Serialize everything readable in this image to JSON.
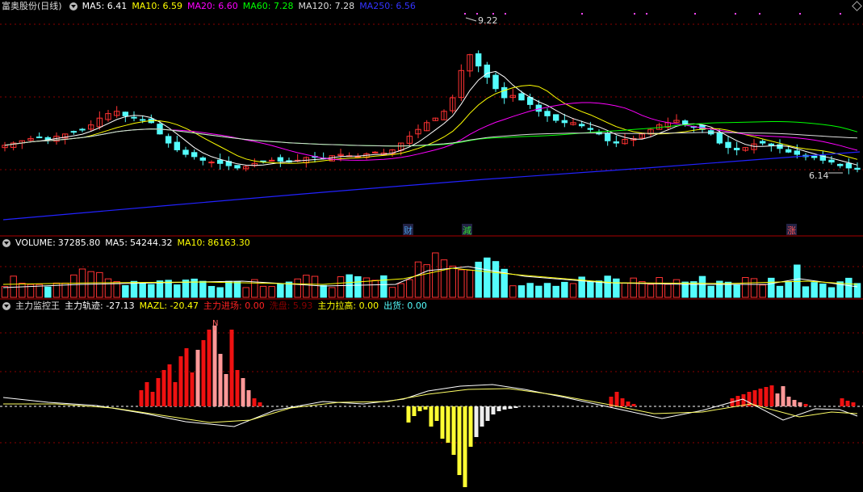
{
  "stock": {
    "name": "富奥股份",
    "period": "(日线)"
  },
  "price_panel": {
    "ma_labels": [
      {
        "label": "MA5",
        "value": "6.41",
        "color": "#ffffff"
      },
      {
        "label": "MA10",
        "value": "6.59",
        "color": "#ffff00"
      },
      {
        "label": "MA20",
        "value": "6.60",
        "color": "#ff00ff"
      },
      {
        "label": "MA60",
        "value": "7.28",
        "color": "#00ff00"
      },
      {
        "label": "MA120",
        "value": "7.28",
        "color": "#dddddd"
      },
      {
        "label": "MA250",
        "value": "6.56",
        "color": "#3333ff"
      }
    ],
    "high_label": "9.22",
    "low_label": "6.14",
    "event_markers": [
      {
        "text": "财",
        "color": "#4a9ae0"
      },
      {
        "text": "減",
        "color": "#33dd33"
      },
      {
        "text": "涨",
        "color": "#ff5555"
      }
    ]
  },
  "volume_panel": {
    "title": "VOLUME:",
    "value": "37285.80",
    "ma5_label": "MA5:",
    "ma5_value": "54244.32",
    "ma10_label": "MA10:",
    "ma10_value": "86163.30"
  },
  "indicator_panel": {
    "name": "主力监控王",
    "items": [
      {
        "label": "主力轨迹:",
        "value": "-27.13",
        "color": "#ffffff"
      },
      {
        "label": "MAZL:",
        "value": "-20.47",
        "color": "#ffff00"
      },
      {
        "label": "主力进场:",
        "value": "0.00",
        "color": "#ff2222"
      },
      {
        "label": "洗盘:",
        "value": "5.93",
        "color": "#880000"
      },
      {
        "label": "主力拉高:",
        "value": "0.00",
        "color": "#ffff00"
      },
      {
        "label": "出货:",
        "value": "0.00",
        "color": "#55ffff"
      }
    ],
    "entry_marker": "N"
  },
  "colors": {
    "up": "#ff3232",
    "down": "#54fcfc",
    "grid": "#8b0000",
    "bg": "#000000"
  },
  "chart_data": [
    {
      "type": "candlestick",
      "title": "富奥股份 (日线)",
      "ma_series": [
        "MA5",
        "MA10",
        "MA20",
        "MA60",
        "MA120",
        "MA250"
      ],
      "ylim": [
        5.2,
        9.8
      ],
      "highest": 9.22,
      "lowest": 6.14
    },
    {
      "type": "bar",
      "title": "VOLUME",
      "series": [
        {
          "name": "VOLUME",
          "last": 37285.8
        },
        {
          "name": "MA5",
          "last": 54244.32
        },
        {
          "name": "MA10",
          "last": 86163.3
        }
      ]
    },
    {
      "type": "bar",
      "title": "主力监控王",
      "series": [
        {
          "name": "主力轨迹",
          "last": -27.13
        },
        {
          "name": "MAZL",
          "last": -20.47
        },
        {
          "name": "主力进场",
          "last": 0.0
        },
        {
          "name": "洗盘",
          "last": 5.93
        },
        {
          "name": "主力拉高",
          "last": 0.0
        },
        {
          "name": "出货",
          "last": 0.0
        }
      ]
    }
  ]
}
